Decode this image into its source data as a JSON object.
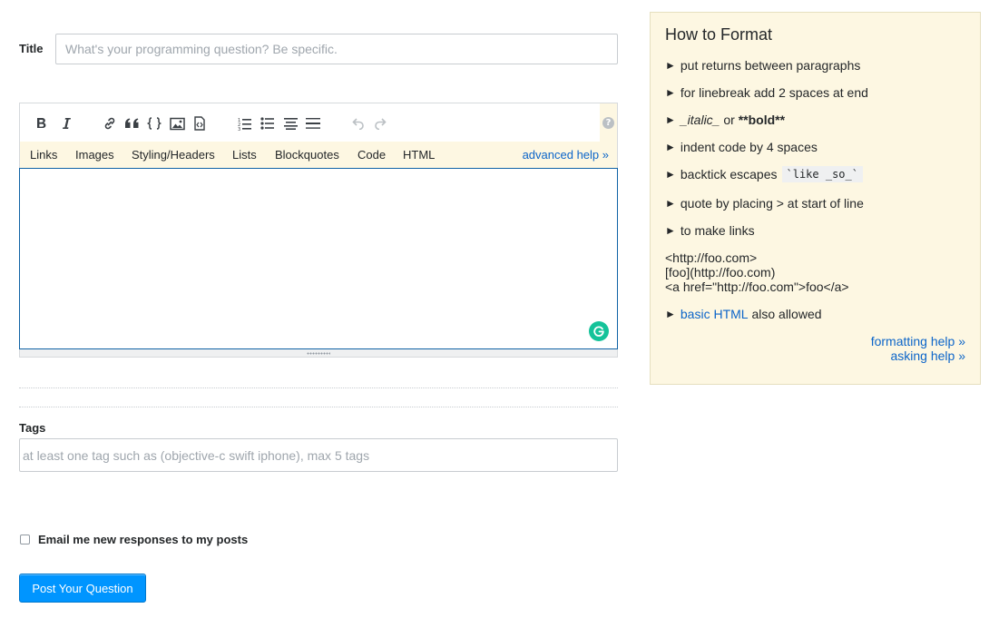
{
  "title": {
    "label": "Title",
    "placeholder": "What's your programming question? Be specific.",
    "value": ""
  },
  "editor": {
    "toolbar": {
      "items": [
        {
          "name": "bold-icon",
          "state": "enabled"
        },
        {
          "name": "italic-icon",
          "state": "enabled"
        },
        {
          "name": "link-icon",
          "state": "enabled"
        },
        {
          "name": "blockquote-icon",
          "state": "enabled"
        },
        {
          "name": "code-icon",
          "state": "enabled"
        },
        {
          "name": "image-icon",
          "state": "enabled"
        },
        {
          "name": "snippet-icon",
          "state": "enabled"
        },
        {
          "name": "numbered-list-icon",
          "state": "enabled"
        },
        {
          "name": "bulleted-list-icon",
          "state": "enabled"
        },
        {
          "name": "heading-icon",
          "state": "enabled"
        },
        {
          "name": "horizontal-rule-icon",
          "state": "enabled"
        },
        {
          "name": "undo-icon",
          "state": "disabled"
        },
        {
          "name": "redo-icon",
          "state": "disabled"
        }
      ],
      "help_glyph": "?"
    },
    "help_tabs": [
      "Links",
      "Images",
      "Styling/Headers",
      "Lists",
      "Blockquotes",
      "Code",
      "HTML"
    ],
    "advanced_help": "advanced help »",
    "body_value": ""
  },
  "tags": {
    "label": "Tags",
    "placeholder": "at least one tag such as (objective-c swift iphone), max 5 tags",
    "value": ""
  },
  "email": {
    "label": "Email me new responses to my posts",
    "checked": false
  },
  "post_button": "Post Your Question",
  "sidebar": {
    "title": "How to Format",
    "bullet_glyph": "►",
    "items": {
      "returns": "put returns between paragraphs",
      "linebreak": "for linebreak add 2 spaces at end",
      "italic": "_italic_",
      "or": " or ",
      "bold": "**bold**",
      "indent": "indent code by 4 spaces",
      "backtick_prefix": "backtick escapes",
      "backtick_code": "`like _so_`",
      "quote": "quote by placing > at start of line",
      "links": "to make links"
    },
    "link_examples": [
      "<http://foo.com>",
      "[foo](http://foo.com)",
      "<a href=\"http://foo.com\">foo</a>"
    ],
    "html_link": "basic HTML",
    "html_suffix": " also allowed",
    "formatting_help": "formatting help »",
    "asking_help": "asking help »"
  },
  "colors": {
    "accent": "#0095ff",
    "link": "#0c65c9",
    "help_bg": "#fdf7e2",
    "grammarly": "#15c39a"
  }
}
